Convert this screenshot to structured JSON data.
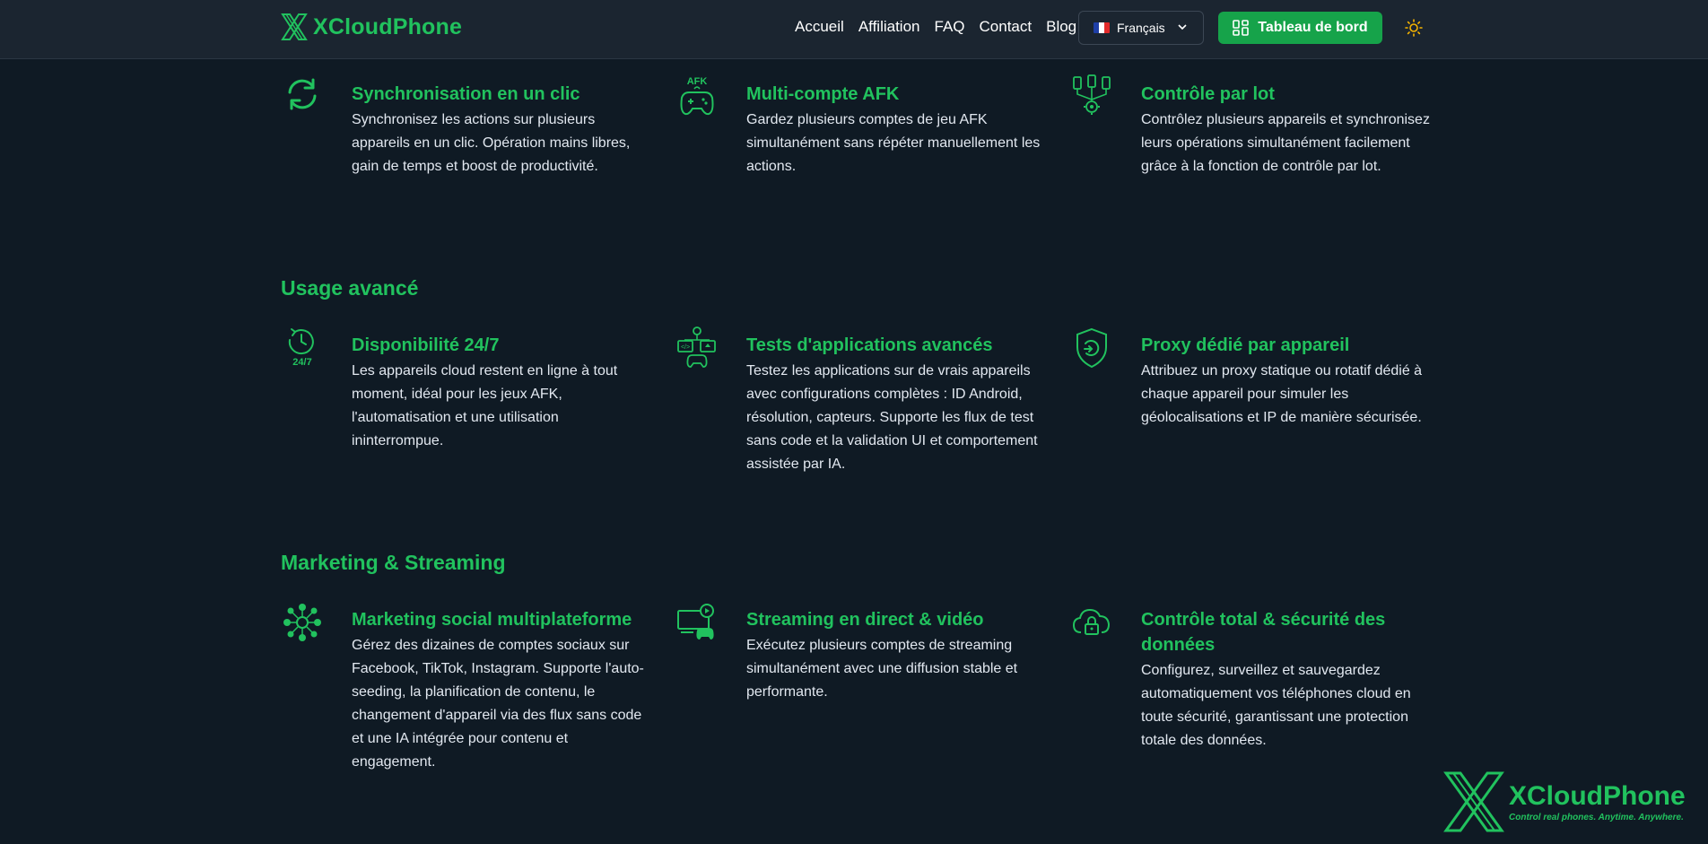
{
  "header": {
    "logo_text": "XCloudPhone",
    "nav": [
      "Accueil",
      "Affiliation",
      "FAQ",
      "Contact",
      "Blog"
    ],
    "language": "Français",
    "dashboard_label": "Tableau de bord"
  },
  "top_features": [
    {
      "title": "Synchronisation en un clic",
      "desc": "Synchronisez les actions sur plusieurs appareils en un clic. Opération mains libres, gain de temps et boost de productivité.",
      "icon": "sync-icon"
    },
    {
      "title": "Multi-compte AFK",
      "desc": "Gardez plusieurs comptes de jeu AFK simultanément sans répéter manuellement les actions.",
      "icon": "afk-gamepad-icon",
      "icon_label": "AFK"
    },
    {
      "title": "Contrôle par lot",
      "desc": "Contrôlez plusieurs appareils et synchronisez leurs opérations simultanément facilement grâce à la fonction de contrôle par lot.",
      "icon": "batch-control-icon"
    }
  ],
  "advanced": {
    "title": "Usage avancé",
    "features": [
      {
        "title": "Disponibilité 24/7",
        "desc": "Les appareils cloud restent en ligne à tout moment, idéal pour les jeux AFK, l'automatisation et une utilisation ininterrompue.",
        "icon": "clock-247-icon",
        "icon_label": "24/7"
      },
      {
        "title": "Tests d'applications avancés",
        "desc": "Testez les applications sur de vrais appareils avec configurations complètes : ID Android, résolution, capteurs. Supporte les flux de test sans code et la validation UI et comportement assistée par IA.",
        "icon": "app-testing-icon"
      },
      {
        "title": "Proxy dédié par appareil",
        "desc": "Attribuez un proxy statique ou rotatif dédié à chaque appareil pour simuler les géolocalisations et IP de manière sécurisée.",
        "icon": "shield-proxy-icon"
      }
    ]
  },
  "marketing": {
    "title": "Marketing & Streaming",
    "features": [
      {
        "title": "Marketing social multiplateforme",
        "desc": "Gérez des dizaines de comptes sociaux sur Facebook, TikTok, Instagram. Supporte l'auto-seeding, la planification de contenu, le changement d'appareil via des flux sans code et une IA intégrée pour contenu et engagement.",
        "icon": "social-network-icon"
      },
      {
        "title": "Streaming en direct & vidéo",
        "desc": "Exécutez plusieurs comptes de streaming simultanément avec une diffusion stable et performante.",
        "icon": "streaming-icon"
      },
      {
        "title": "Contrôle total & sécurité des données",
        "desc": "Configurez, surveillez et sauvegardez automatiquement vos téléphones cloud en toute sécurité, garantissant une protection totale des données.",
        "icon": "cloud-lock-icon"
      }
    ]
  },
  "watermark": {
    "title": "XCloudPhone",
    "tagline": "Control real phones. Anytime. Anywhere."
  },
  "colors": {
    "accent": "#21c25e",
    "background": "#0f1a24",
    "header": "#1b2530",
    "button": "#16a34a"
  }
}
